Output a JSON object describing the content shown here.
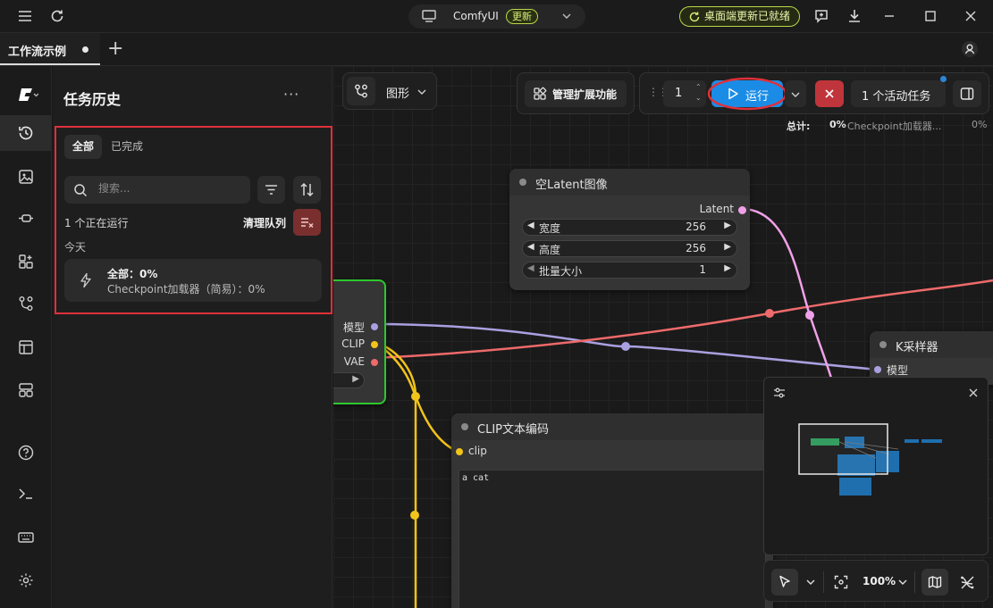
{
  "titlebar": {
    "app_name": "ComfyUI",
    "update_badge": "更新",
    "desktop_update": "桌面端更新已就绪"
  },
  "tabs": {
    "active_label": "工作流示例",
    "add_label": "+"
  },
  "panel": {
    "title": "任务历史",
    "more": "···",
    "tab_all": "全部",
    "tab_done": "已完成",
    "search_placeholder": "搜索...",
    "running": "1 个正在运行",
    "clear_queue": "清理队列",
    "today": "今天",
    "job_title": "全部：0%",
    "job_sub": "Checkpoint加载器（简易）：0%"
  },
  "canvas": {
    "graph_label": "图形",
    "manage_ext": "管理扩展功能",
    "batch_count": "1",
    "run_label": "运行",
    "active_tasks": "1 个活动任务",
    "total_label": "总计:",
    "total_pct": "0%",
    "total_node": "Checkpoint加载器...",
    "total_right": "0%",
    "zoom": "100%"
  },
  "nodes": {
    "latent": {
      "title": "空Latent图像",
      "output": "Latent",
      "width_label": "宽度",
      "width_val": "256",
      "height_label": "高度",
      "height_val": "256",
      "batch_label": "批量大小",
      "batch_val": "1"
    },
    "loader": {
      "out_model": "模型",
      "out_clip": "CLIP",
      "out_vae": "VAE"
    },
    "clip": {
      "title": "CLIP文本编码",
      "input": "clip",
      "text": "a cat"
    },
    "ksampler": {
      "title": "K采样器",
      "input_model": "模型"
    }
  },
  "colors": {
    "accent_blue": "#1a8ce6",
    "clear_red": "#7a2f2f",
    "stop_red": "#c0353b",
    "highlight_red": "#e0303a",
    "loader_green": "#2ec82e",
    "wire_model": "#a9a0e0",
    "wire_clip": "#f2c31a",
    "wire_vae": "#ef6a6a",
    "wire_latent": "#f0a0e8",
    "badge_green": "#b7d94a"
  },
  "icons": [
    "menu-icon",
    "refresh-icon",
    "monitor-icon",
    "chevron-down-icon",
    "feedback-icon",
    "download-icon",
    "minimize-icon",
    "maximize-icon",
    "close-icon",
    "user-icon",
    "comfy-logo-icon",
    "history-icon",
    "images-icon",
    "nodes-icon",
    "extensions-icon",
    "workflows-icon",
    "templates-icon",
    "models-icon",
    "help-icon",
    "terminal-icon",
    "keyboard-icon",
    "settings-icon",
    "search-icon",
    "filter-icon",
    "sort-icon",
    "clear-queue-icon",
    "lightning-icon",
    "graph-icon",
    "puzzle-icon",
    "play-icon",
    "panel-toggle-icon",
    "cursor-icon",
    "fit-view-icon",
    "map-icon",
    "links-off-icon",
    "minimap-settings-icon"
  ]
}
